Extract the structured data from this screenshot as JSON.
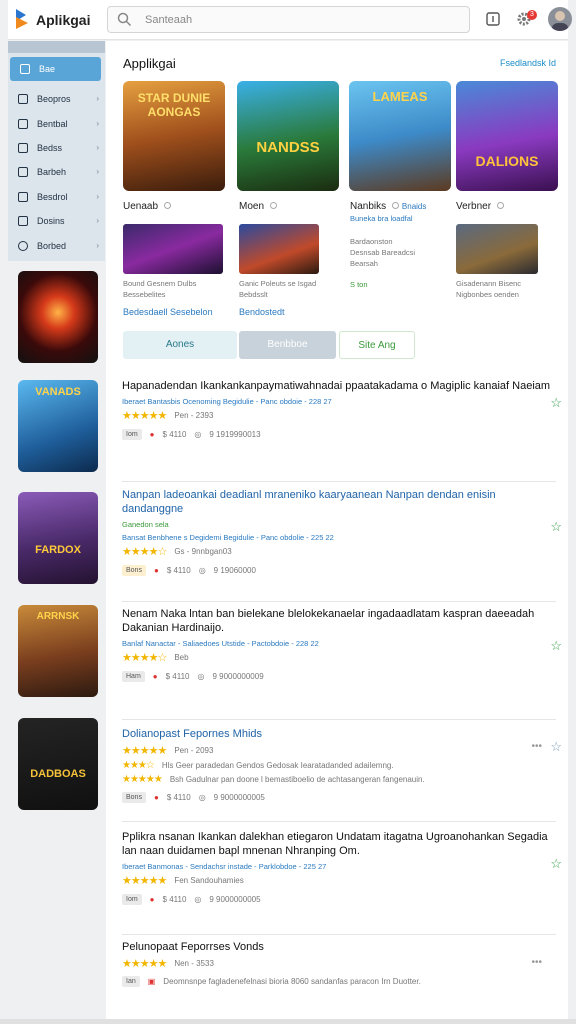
{
  "app": {
    "title": "Aplikgai"
  },
  "search": {
    "placeholder": "Santeaah"
  },
  "notifications": {
    "count": "3"
  },
  "sidebar": {
    "items": [
      {
        "label": "Bae",
        "active": true
      },
      {
        "label": "Beopros"
      },
      {
        "label": "Bentbal"
      },
      {
        "label": "Bedss"
      },
      {
        "label": "Barbeh"
      },
      {
        "label": "Besdrol"
      },
      {
        "label": "Dosins"
      },
      {
        "label": "Borbed"
      }
    ]
  },
  "section": {
    "title": "Applikgai",
    "link": "Fsedlandsk Id"
  },
  "featured": [
    {
      "art": "STAR DUNIE AONGAS",
      "name": "Uenaab"
    },
    {
      "art": "NANDSS",
      "name": "Moen"
    },
    {
      "art": "LAMEAS",
      "name": "Nanbiks",
      "extra": "Bnaids"
    },
    {
      "art": "DALIONS",
      "name": "Verbner"
    }
  ],
  "featured_sub": {
    "nanbiks_line": "Buneka bra loadfal",
    "row2": [
      {
        "lines": [
          "Bound Gesnem Dulbs",
          "Bessebelites"
        ]
      },
      {
        "lines": [
          "Ganic Poleuts se Isgad",
          "Bebdsslt"
        ]
      },
      {
        "lines": [
          "Bardaonston",
          "Desnsab Bareadcsi",
          "Bearsah"
        ],
        "extra": "S ton"
      },
      {
        "lines": [
          "Gisadenann Bisenc",
          "Nigbonbes oenden"
        ]
      }
    ],
    "links": [
      "Bedesdaell Sesebelon",
      "Bendostedt"
    ]
  },
  "tabs": [
    "Aones",
    "Benbboe",
    "Site Ang"
  ],
  "items": [
    {
      "title": "Hapanadendan Ikankankanpaymatiwahnadai ppaatakadama o Magiplic kanaiaf Naeiam",
      "meta": "Iberaet Bantasbis Ocenoming Begidulie - Panc obdoie - 228 27",
      "stars": "★★★★★",
      "rating_text": "Pen - 2393",
      "tag": "Iom",
      "price": "$ 4110",
      "views": "9 1919990013"
    },
    {
      "title": "Nanpan ladeoankai deadianl mraneniko kaaryaanean Nanpan dendan enisin dandanggne",
      "ttl_extra": "Ganedon sela",
      "meta": "Bansat Benbhene s Degidemi Begidulie - Panc obdolie - 225 22",
      "stars": "★★★★☆",
      "rating_text": "Gs - 9nnbgan03",
      "tag": "Bons",
      "price": "$ 4110",
      "views": "9 19060000"
    },
    {
      "title": "Nenam Naka lntan ban bielekane blelokekanaelar ingadaadlatam kaspran daeeadah Dakanian Hardinaijo.",
      "meta": "Banlaf Nanactar - Saliaedoes Utstide - Pactobdoie - 228 22",
      "stars": "★★★★☆",
      "rating_text": "Beb",
      "tag": "Ham",
      "price": "$ 4110",
      "views": "9 9000000009"
    },
    {
      "title": "Dolianopast Fepornes Mhids",
      "meta": "",
      "stars": "★★★★★",
      "rating_text": "Pen - 2093",
      "line2": "Hls Geer paradedan Gendos Gedosak Iearatadanded adailemng.",
      "line3": "Bsh Gadulnar pan doone l bemastiboelio de achtasangeran fangenauin.",
      "tag": "Bons",
      "price": "$ 4110",
      "views": "9 9000000005"
    },
    {
      "title": "Pplikra nsanan Ikankan dalekhan etiegaron Undatam itagatna Ugroanohankan Segadia lan naan duidamen bapl mnenan Nhranping Om.",
      "meta": "Iberaet Banmonas - Sendachsr instade - Parklobdoe - 225 27",
      "stars": "★★★★★",
      "rating_text": "Fen Sandouhamies",
      "tag": "Iom",
      "price": "$ 4110",
      "views": "9 9000000005"
    },
    {
      "title": "Pelunopaat Feporrses Vonds",
      "meta": "",
      "stars": "★★★★★",
      "rating_text": "Nen - 3533",
      "line3": "Deomnsnpe fagladenefelnasi bioria 8060 sandanfas paracon Irn Duotter.",
      "tag": "Ian"
    }
  ],
  "colors": {
    "accent": "#1a8cc8",
    "sidebar_active": "#5aa5d8",
    "star": "#f2b600"
  }
}
